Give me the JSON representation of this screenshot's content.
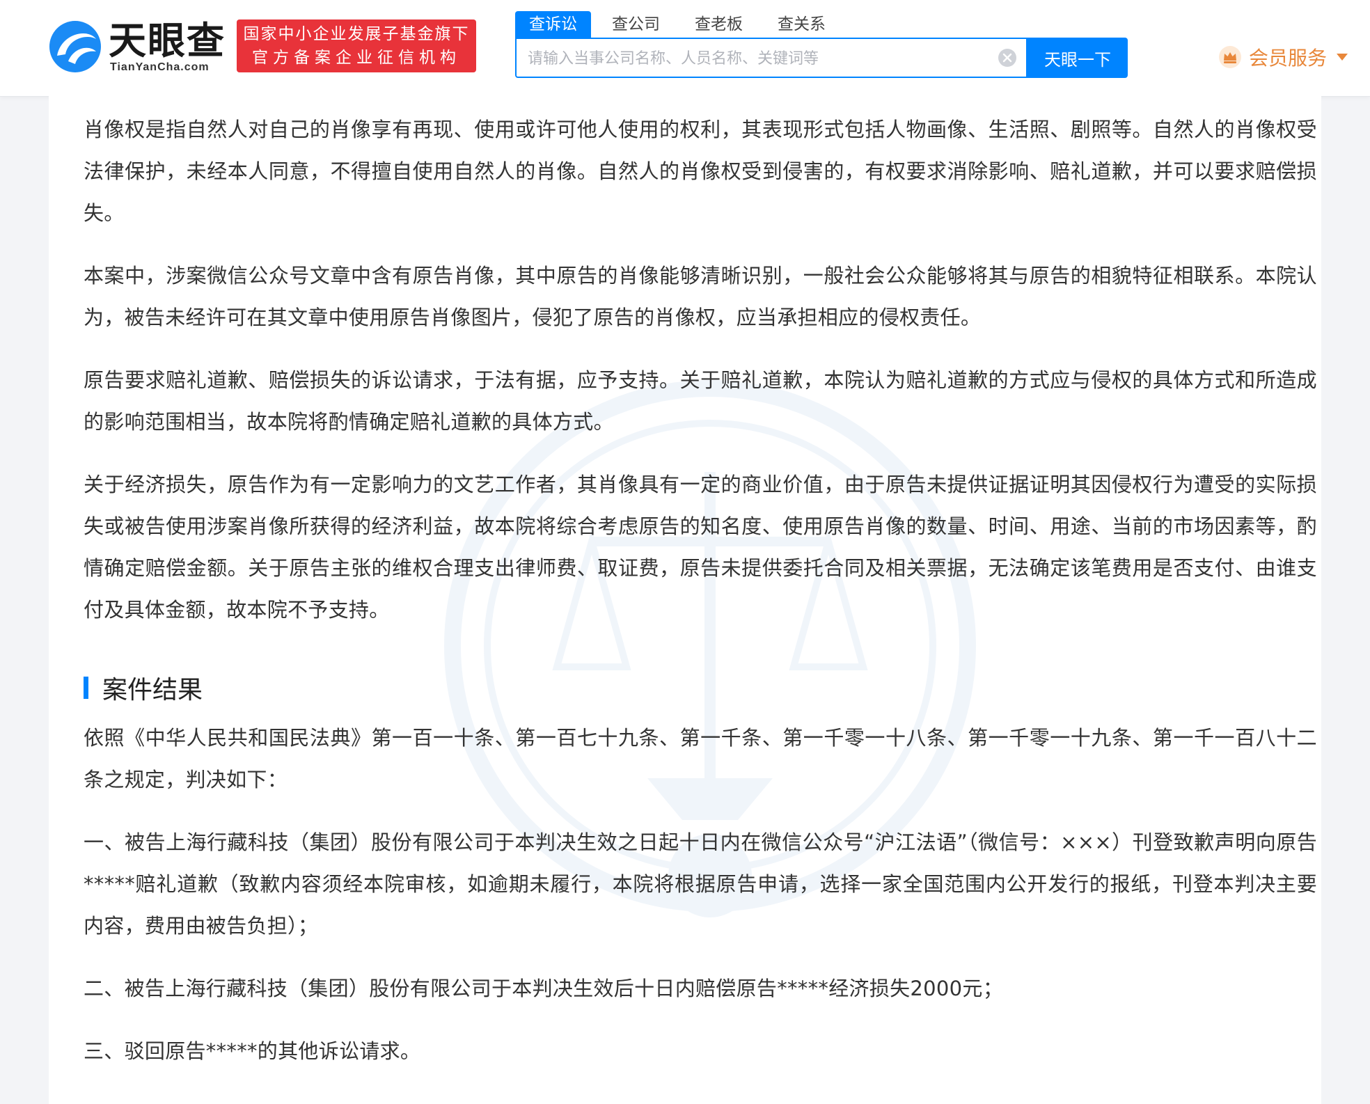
{
  "header": {
    "logo_text": "天眼查",
    "logo_sub": "TianYanCha.com",
    "badge_line1": "国家中小企业发展子基金旗下",
    "badge_line2": "官方备案企业征信机构",
    "tabs": [
      {
        "label": "查诉讼",
        "active": true
      },
      {
        "label": "查公司",
        "active": false
      },
      {
        "label": "查老板",
        "active": false
      },
      {
        "label": "查关系",
        "active": false
      }
    ],
    "search_placeholder": "请输入当事公司名称、人员名称、关键词等",
    "search_value": "",
    "search_button": "天眼一下",
    "vip_label": "会员服务",
    "accent_color": "#0084ff",
    "badge_color": "#e8333a",
    "vip_color": "#e8873a"
  },
  "document": {
    "paragraphs_top": [
      "肖像权是指自然人对自己的肖像享有再现、使用或许可他人使用的权利，其表现形式包括人物画像、生活照、剧照等。自然人的肖像权受法律保护，未经本人同意，不得擅自使用自然人的肖像。自然人的肖像权受到侵害的，有权要求消除影响、赔礼道歉，并可以要求赔偿损失。",
      "本案中，涉案微信公众号文章中含有原告肖像，其中原告的肖像能够清晰识别，一般社会公众能够将其与原告的相貌特征相联系。本院认为，被告未经许可在其文章中使用原告肖像图片，侵犯了原告的肖像权，应当承担相应的侵权责任。",
      "原告要求赔礼道歉、赔偿损失的诉讼请求，于法有据，应予支持。关于赔礼道歉，本院认为赔礼道歉的方式应与侵权的具体方式和所造成的影响范围相当，故本院将酌情确定赔礼道歉的具体方式。",
      "关于经济损失，原告作为有一定影响力的文艺工作者，其肖像具有一定的商业价值，由于原告未提供证据证明其因侵权行为遭受的实际损失或被告使用涉案肖像所获得的经济利益，故本院将综合考虑原告的知名度、使用原告肖像的数量、时间、用途、当前的市场因素等，酌情确定赔偿金额。关于原告主张的维权合理支出律师费、取证费，原告未提供委托合同及相关票据，无法确定该笔费用是否支付、由谁支付及具体金额，故本院不予支持。"
    ],
    "section_title": "案件结果",
    "paragraphs_result": [
      "依照《中华人民共和国民法典》第一百一十条、第一百七十九条、第一千条、第一千零一十八条、第一千零一十九条、第一千一百八十二条之规定，判决如下：",
      "一、被告上海行藏科技（集团）股份有限公司于本判决生效之日起十日内在微信公众号“沪江法语”（微信号：×××）刊登致歉声明向原告*****赔礼道歉（致歉内容须经本院审核，如逾期未履行，本院将根据原告申请，选择一家全国范围内公开发行的报纸，刊登本判决主要内容，费用由被告负担）；",
      "二、被告上海行藏科技（集团）股份有限公司于本判决生效后十日内赔偿原告*****经济损失2000元；",
      "三、驳回原告*****的其他诉讼请求。"
    ]
  }
}
